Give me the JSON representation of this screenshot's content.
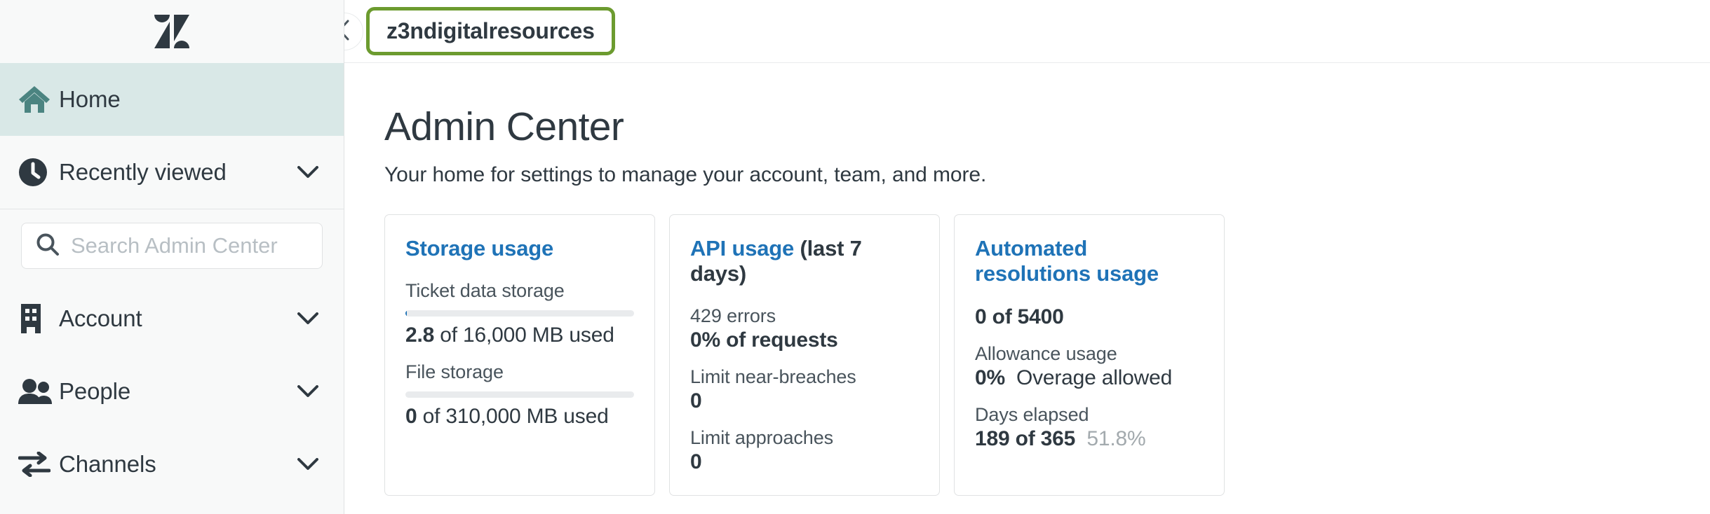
{
  "sidebar": {
    "logo_name": "zendesk-logo",
    "items": [
      {
        "label": "Home",
        "icon": "home-icon",
        "active": true,
        "chevron": false
      },
      {
        "label": "Recently viewed",
        "icon": "clock-icon",
        "active": false,
        "chevron": true
      },
      {
        "label": "Account",
        "icon": "building-icon",
        "active": false,
        "chevron": true
      },
      {
        "label": "People",
        "icon": "people-icon",
        "active": false,
        "chevron": true
      },
      {
        "label": "Channels",
        "icon": "channels-icon",
        "active": false,
        "chevron": true
      }
    ],
    "search": {
      "placeholder": "Search Admin Center",
      "value": "",
      "icon": "search-icon"
    }
  },
  "topbar": {
    "collapse_icon": "chevron-left-icon",
    "breadcrumb": "z3ndigitalresources",
    "highlight_color": "#6c9b2f"
  },
  "page": {
    "title": "Admin Center",
    "subtitle": "Your home for settings to manage your account, team, and more."
  },
  "cards": {
    "storage": {
      "title": "Storage usage",
      "ticket_label": "Ticket data storage",
      "ticket_bar_percent": 0.5,
      "ticket_value_bold": "2.8",
      "ticket_value_rest": " of 16,000 MB used",
      "file_label": "File storage",
      "file_bar_percent": 0,
      "file_value_bold": "0",
      "file_value_rest": " of 310,000 MB used"
    },
    "api": {
      "title": "API usage",
      "title_suffix": " (last 7 days)",
      "errors_label": "429 errors",
      "errors_value": "0% of requests",
      "near_breaches_label": "Limit near-breaches",
      "near_breaches_value": "0",
      "approaches_label": "Limit approaches",
      "approaches_value": "0"
    },
    "automated": {
      "title": "Automated resolutions usage",
      "total_value": "0 of 5400",
      "allowance_label": "Allowance usage",
      "allowance_percent": "0%",
      "allowance_note": "Overage allowed",
      "days_label": "Days elapsed",
      "days_value": "189 of 365",
      "days_percent": "51.8%"
    }
  },
  "colors": {
    "link": "#1f73b7",
    "active_row": "#d9e8e7",
    "home_icon": "#4b8481",
    "highlight": "#6c9b2f",
    "text": "#2f3941"
  }
}
